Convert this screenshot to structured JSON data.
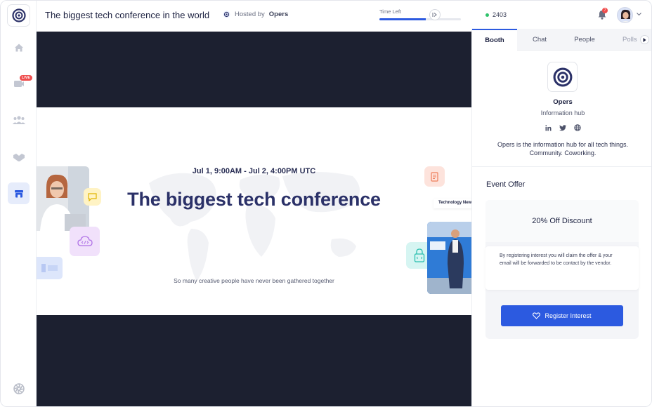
{
  "header": {
    "title": "The biggest tech conference in the world",
    "hosted_prefix": "Hosted by",
    "host": "Opers",
    "time_left_label": "Time Left",
    "time_left_progress": 0.57,
    "viewer_count": "2403",
    "notification_count": "7"
  },
  "sidebar": {
    "live_badge": "LIVE",
    "items": [
      "home-icon",
      "stage-icon",
      "people-icon",
      "handshake-icon",
      "booth-icon"
    ]
  },
  "banner": {
    "date": "Jul 1, 9:00AM - Jul 2, 4:00PM UTC",
    "title": "The biggest tech conference",
    "subtitle": "So many creative people have never been gathered together",
    "tag": "Technology New"
  },
  "panel": {
    "tabs": [
      "Booth",
      "Chat",
      "People",
      "Polls"
    ],
    "active_tab": "Booth",
    "booth": {
      "name": "Opers",
      "subtitle": "Information hub",
      "description": "Opers is the information hub for all tech things. Community. Coworking."
    },
    "offer": {
      "section_title": "Event Offer",
      "headline": "20% Off Discount",
      "text": "By registering interest you will claim the offer & your email will be forwarded to be contact by the vendor.",
      "button_label": "Register Interest"
    }
  },
  "colors": {
    "accent": "#2c5ae0",
    "brand": "#2b3168",
    "live": "#ef4d4d",
    "online": "#2fc26b",
    "stage_bg": "#1c2030"
  }
}
